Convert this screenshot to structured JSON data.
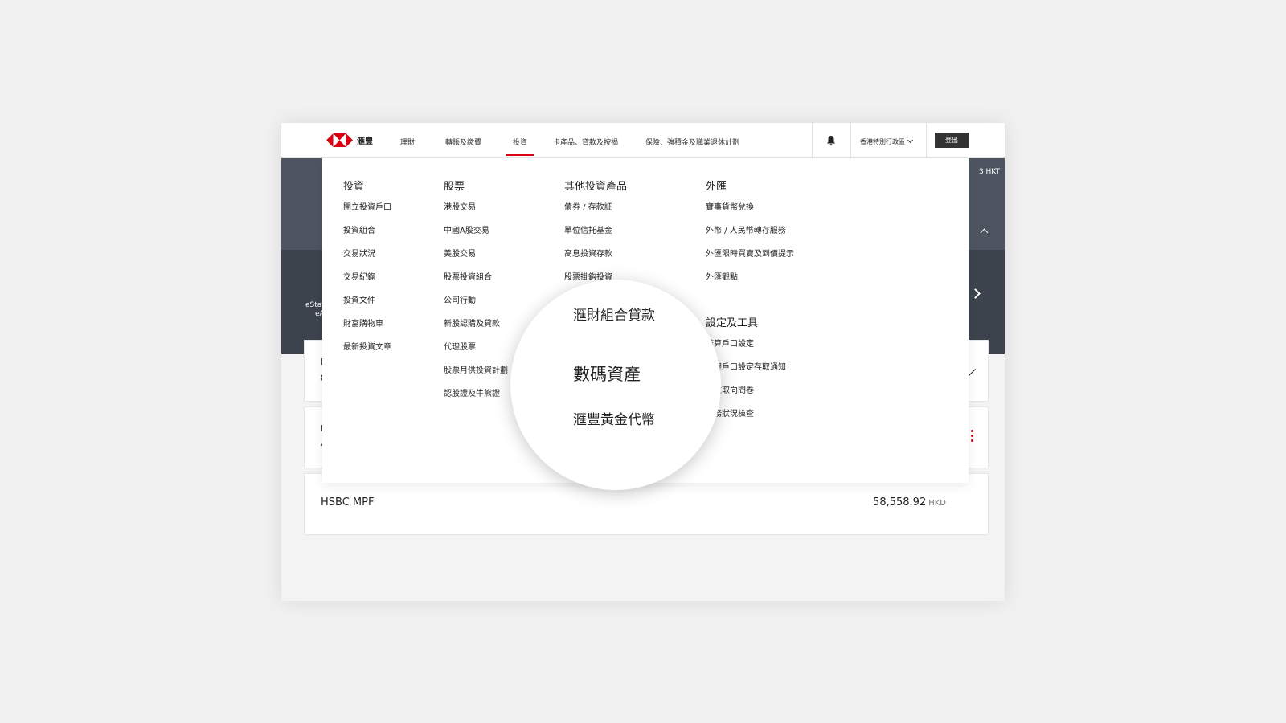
{
  "nav": {
    "logo_text": "滙豐",
    "items": [
      "理財",
      "轉賬及繳費",
      "投資",
      "卡產品、貸款及按揭",
      "保險、強積金及職業退休計劃"
    ],
    "active_index": 2,
    "region": "香港特別行政區",
    "logout_label": "登出"
  },
  "banner": {
    "hkt": "3 HKT",
    "estat_line1": "eStat",
    "estat_line2": "eA"
  },
  "menu": {
    "columns": [
      {
        "heading": "投資",
        "links": [
          "開立投資戶口",
          "投資組合",
          "交易狀況",
          "交易紀錄",
          "投資文件",
          "財富購物車",
          "最新投資文章"
        ]
      },
      {
        "heading": "股票",
        "links": [
          "港股交易",
          "中國A股交易",
          "美股交易",
          "股票投資組合",
          "公司行動",
          "新股認購及貸款",
          "代理股票",
          "股票月供投資計劃",
          "認股證及牛熊證"
        ]
      },
      {
        "heading": "其他投資產品",
        "links": [
          "債券 / 存款証",
          "單位信托基金",
          "高息投資存款",
          "股票掛鈎投資"
        ]
      },
      {
        "heading": "外匯",
        "links": [
          "實事貨幣兌換",
          "外幣 / 人民幣轉存服務",
          "外匯限時買賣及到價提示",
          "外匯觀點"
        ]
      }
    ],
    "settings": {
      "heading": "設定及工具",
      "links": [
        "結算戶口設定",
        "代理戶口設定存取通知",
        "風險取向問卷",
        "財務狀況檢查"
      ]
    }
  },
  "magnifier": {
    "items": [
      "滙財組合貸款",
      "數碼資產",
      "滙豐黃金代幣"
    ]
  },
  "cards": {
    "card1_stub": [
      "I",
      "8"
    ],
    "card2_stub": [
      "I",
      "4"
    ],
    "mpf_name": "HSBC MPF",
    "mpf_amount": "58,558.92",
    "mpf_currency": "HKD"
  },
  "colors": {
    "brand_red": "#db0011",
    "banner": "#4d5560",
    "logout_bg": "#333333"
  }
}
